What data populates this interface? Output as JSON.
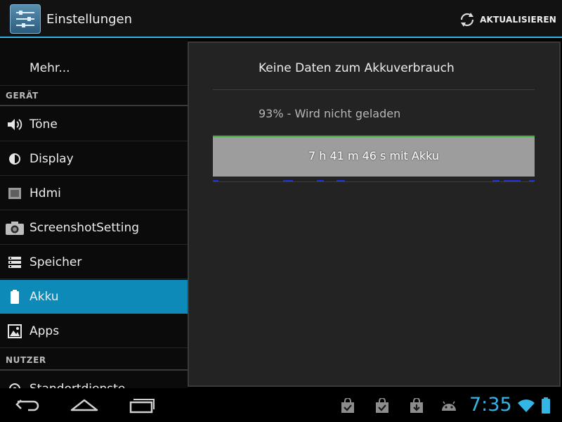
{
  "actionbar": {
    "title": "Einstellungen",
    "refresh_label": "AKTUALISIEREN"
  },
  "sidebar": {
    "items": [
      {
        "label": "Mehr...",
        "icon": "none"
      },
      {
        "label": "GERÄT",
        "type": "header"
      },
      {
        "label": "Töne",
        "icon": "speaker-icon"
      },
      {
        "label": "Display",
        "icon": "brightness-icon"
      },
      {
        "label": "Hdmi",
        "icon": "hdmi-icon"
      },
      {
        "label": "ScreenshotSetting",
        "icon": "camera-icon"
      },
      {
        "label": "Speicher",
        "icon": "storage-icon"
      },
      {
        "label": "Akku",
        "icon": "battery-icon",
        "selected": true
      },
      {
        "label": "Apps",
        "icon": "apps-icon"
      },
      {
        "label": "NUTZER",
        "type": "header"
      },
      {
        "label": "Standortdienste",
        "icon": "location-icon"
      }
    ]
  },
  "detail": {
    "title": "Keine Daten zum Akkuverbrauch",
    "status": "93% - Wird nicht geladen",
    "graph_label": "7 h 41 m 46 s mit Akku",
    "battery_level": 0.93
  },
  "statusbar": {
    "time": "7:35"
  },
  "colors": {
    "accent": "#33b5e5",
    "selected": "#0d8ab8",
    "graph_line": "#3fb23f",
    "graph_fill": "#9d9d9d"
  }
}
